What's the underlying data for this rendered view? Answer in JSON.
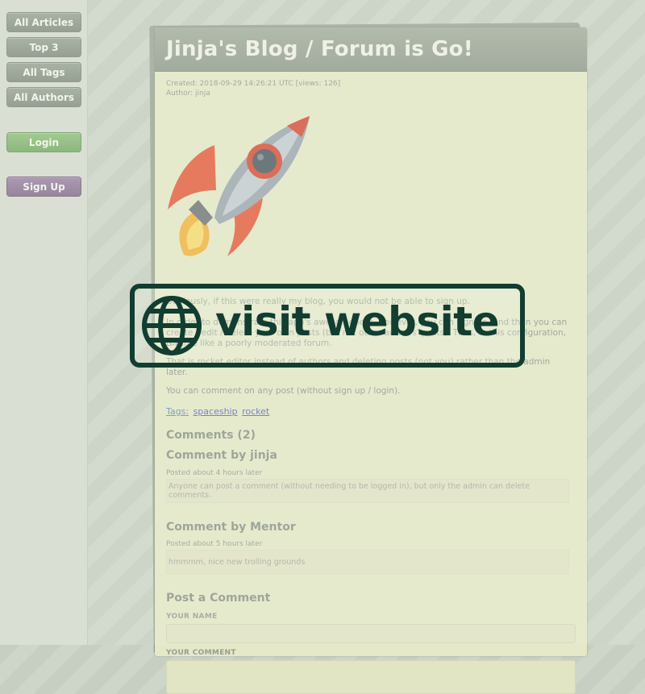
{
  "sidebar": {
    "nav": [
      {
        "label": "All Articles"
      },
      {
        "label": "Top 3"
      },
      {
        "label": "All Tags"
      },
      {
        "label": "All Authors"
      }
    ],
    "login": "Login",
    "signup": "Sign Up"
  },
  "article": {
    "title": "Jinja's Blog / Forum is Go!",
    "created": "Created: 2018-09-29 14:26:21 UTC [views: 126]",
    "author": "Author: jinja",
    "image_icon": "rocket-icon",
    "paragraphs": [
      "Obviously, if this were really my blog, you would not be able to sign up.",
      "In order to demonstrate this app's awesomeness, however, you can sign up, and then you can",
      "create / edit / delete your own posts (but not other authors' posts). Thus, in this configuration, this",
      "is more like a poorly moderated forum.",
      "That is rocket editor instead of authors and deleting posts (not you) rather than the admin",
      "later.",
      "You can comment on any post (without sign up / login)."
    ],
    "tags_label": "Tags:",
    "tags": [
      "spaceship",
      "rocket"
    ]
  },
  "comments": {
    "heading": "Comments (2)",
    "items": [
      {
        "title": "Comment by jinja",
        "posted": "Posted about 4 hours later",
        "body": "Anyone can post a comment (without needing to be logged in), but only the admin can delete comments."
      },
      {
        "title": "Comment by Mentor",
        "posted": "Posted about 5 hours later",
        "body": "hmmmm, nice new trolling grounds"
      }
    ]
  },
  "post_form": {
    "heading": "Post a Comment",
    "name_label": "YOUR NAME",
    "comment_label": "YOUR COMMENT"
  },
  "overlay": {
    "text": "visit website",
    "icon": "globe-icon"
  },
  "colors": {
    "banner": "#123d31",
    "login": "#7fb56e",
    "signup": "#8d7497",
    "tag_link": "#5468c4"
  }
}
